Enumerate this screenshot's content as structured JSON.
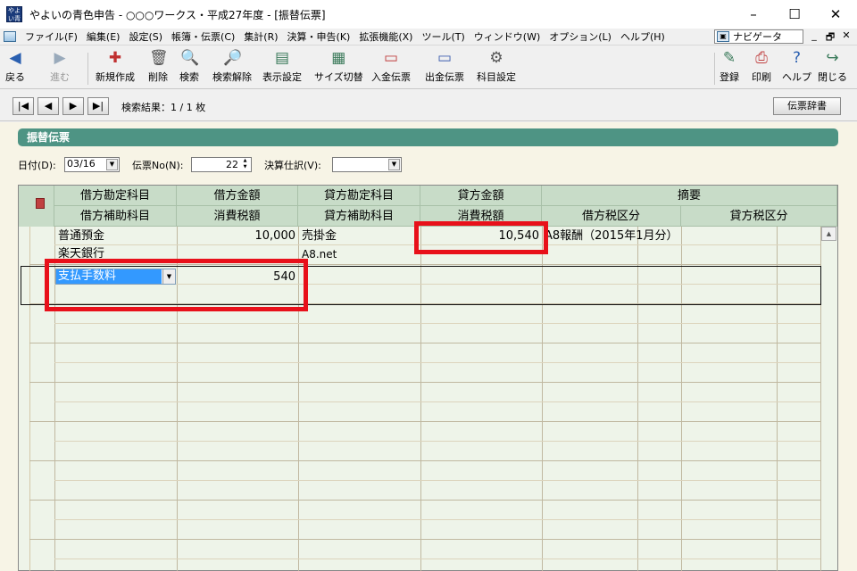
{
  "titlebar": {
    "app_icon_text": "やよい青色",
    "title": "やよいの青色申告 - ○○○ワークス・平成27年度 - [振替伝票]",
    "minimize": "–",
    "maximize": "☐",
    "close": "✕"
  },
  "menu": {
    "items": [
      "ファイル(F)",
      "編集(E)",
      "設定(S)",
      "帳簿・伝票(C)",
      "集計(R)",
      "決算・申告(K)",
      "拡張機能(X)",
      "ツール(T)",
      "ウィンドウ(W)",
      "オプション(L)",
      "ヘルプ(H)"
    ],
    "navigator": "ナビゲータ",
    "mdi_min": "_",
    "mdi_restore": "🗗",
    "mdi_close": "✕"
  },
  "toolbar": {
    "back": "戻る",
    "forward": "進む",
    "new": "新規作成",
    "delete": "削除",
    "search": "検索",
    "clear_search": "検索解除",
    "display": "表示設定",
    "resize": "サイズ切替",
    "deposit": "入金伝票",
    "withdraw": "出金伝票",
    "account_settings": "科目設定",
    "register": "登録",
    "print": "印刷",
    "help": "ヘルプ",
    "close": "閉じる"
  },
  "nav": {
    "first": "|◀",
    "prev": "◀",
    "next": "▶",
    "last": "▶|",
    "search_result": "検索結果：1 / 1 枚",
    "dictionary_button": "伝票辞書"
  },
  "form": {
    "section_title": "振替伝票",
    "date_label": "日付(D):",
    "date_value": "03/16",
    "voucher_no_label": "伝票No(N):",
    "voucher_no_value": "22",
    "settlement_label": "決算仕訳(V):",
    "settlement_value": ""
  },
  "table": {
    "headers_row1": [
      "借方勘定科目",
      "借方金額",
      "貸方勘定科目",
      "貸方金額",
      "摘要"
    ],
    "headers_row2": [
      "借方補助科目",
      "消費税額",
      "貸方補助科目",
      "消費税額",
      "借方税区分",
      "貸方税区分"
    ],
    "rows": [
      {
        "debit_account": "普通預金",
        "debit_amount": "10,000",
        "credit_account": "売掛金",
        "credit_amount": "10,540",
        "memo": "A8報酬（2015年1月分）",
        "debit_sub": "楽天銀行",
        "debit_tax": "",
        "credit_sub": "A8.net",
        "credit_tax": ""
      },
      {
        "debit_account": "支払手数料",
        "debit_amount": "540",
        "credit_account": "",
        "credit_amount": "",
        "memo": "",
        "debit_sub": "",
        "debit_tax": "",
        "credit_sub": "",
        "credit_tax": ""
      }
    ]
  },
  "colors": {
    "section_bar": "#4e9484",
    "header": "#c8dcc8",
    "grid_bg": "#eef4e9",
    "highlight": "#e8101a",
    "selection": "#3399ff"
  }
}
